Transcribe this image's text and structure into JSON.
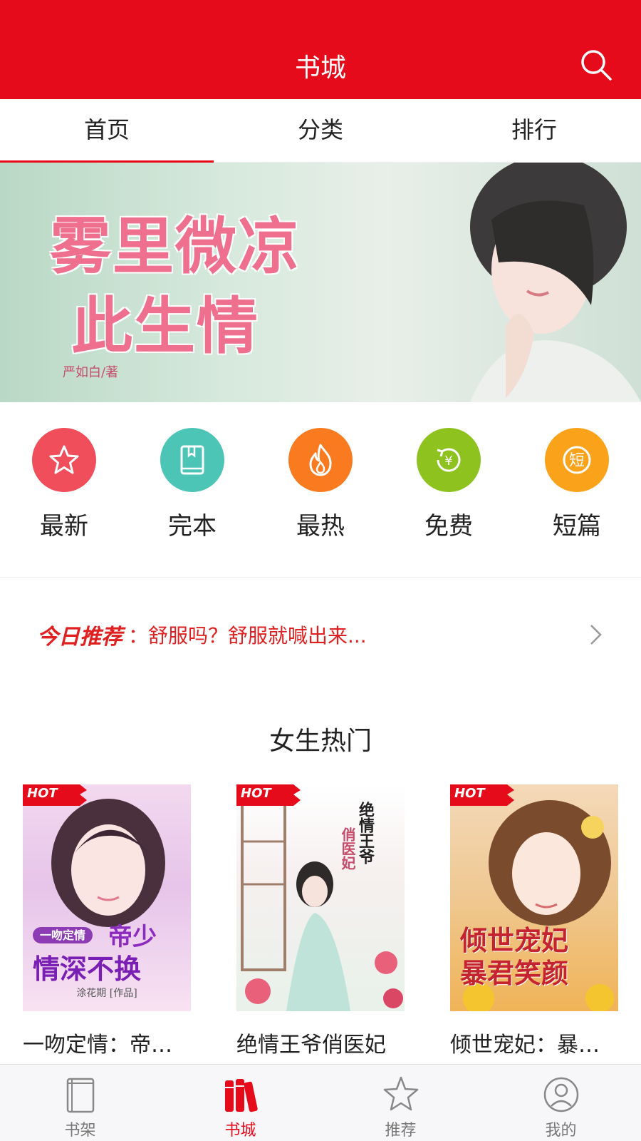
{
  "header": {
    "title": "书城",
    "search_icon": "search-icon",
    "color": "#e50b1a"
  },
  "tabs": [
    {
      "label": "首页",
      "active": true
    },
    {
      "label": "分类",
      "active": false
    },
    {
      "label": "排行",
      "active": false
    }
  ],
  "banner": {
    "title_line1": "雾里微凉",
    "title_line2": "此生情",
    "author": "严如白/著",
    "page_count": 3,
    "active_page": 1
  },
  "categories": [
    {
      "label": "最新",
      "icon": "star-icon",
      "color": "#f04e5b"
    },
    {
      "label": "完本",
      "icon": "book-icon",
      "color": "#4cc4b6"
    },
    {
      "label": "最热",
      "icon": "flame-icon",
      "color": "#f97a1f"
    },
    {
      "label": "免费",
      "icon": "yen-refresh-icon",
      "color": "#8dc21f"
    },
    {
      "label": "短篇",
      "icon": "short-icon",
      "color": "#fba21b"
    }
  ],
  "recommend": {
    "prefix": "今日推荐",
    "text": "：舒服吗？舒服就喊出来..."
  },
  "section": {
    "title": "女生热门"
  },
  "books": [
    {
      "title": "一吻定情：帝…",
      "badge": "HOT",
      "cover_text_1": "帝少",
      "cover_text_2": "情深不换",
      "cover_tag": "一吻定情",
      "cover_author": "涂花期 [作品]"
    },
    {
      "title": "绝情王爷俏医妃",
      "badge": "HOT",
      "cover_text_1": "绝情王爷",
      "cover_text_2": "俏医妃"
    },
    {
      "title": "倾世宠妃：暴…",
      "badge": "HOT",
      "cover_text_1": "倾世宠妃",
      "cover_text_2": "暴君笑颜"
    }
  ],
  "bottom_nav": [
    {
      "label": "书架",
      "icon": "bookshelf-icon",
      "active": false
    },
    {
      "label": "书城",
      "icon": "bookstore-icon",
      "active": true
    },
    {
      "label": "推荐",
      "icon": "star-outline-icon",
      "active": false
    },
    {
      "label": "我的",
      "icon": "profile-icon",
      "active": false
    }
  ]
}
